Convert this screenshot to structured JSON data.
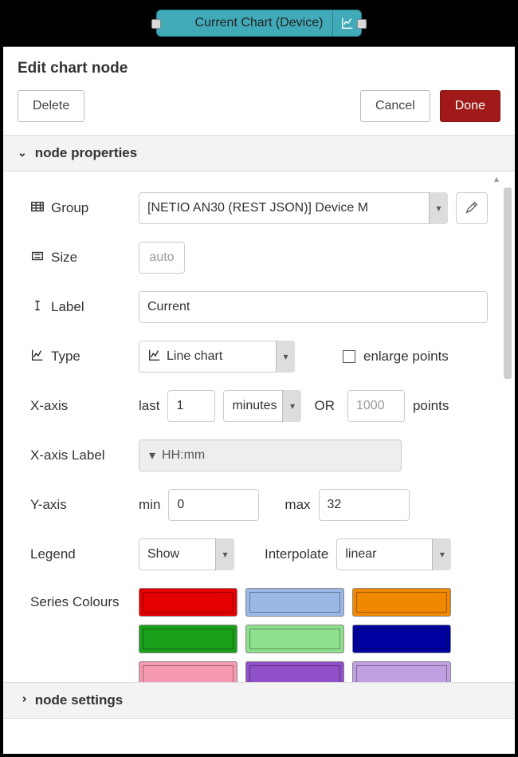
{
  "node": {
    "title": "Current Chart (Device)"
  },
  "header": {
    "title": "Edit chart node"
  },
  "buttons": {
    "delete": "Delete",
    "cancel": "Cancel",
    "done": "Done"
  },
  "sections": {
    "properties": "node properties",
    "settings": "node settings"
  },
  "labels": {
    "group": "Group",
    "size": "Size",
    "label": "Label",
    "type": "Type",
    "xaxis": "X-axis",
    "xaxis_label": "X-axis Label",
    "yaxis": "Y-axis",
    "legend": "Legend",
    "interpolate": "Interpolate",
    "series": "Series Colours",
    "enlarge": "enlarge points",
    "last": "last",
    "or": "OR",
    "points": "points",
    "min": "min",
    "max": "max"
  },
  "fields": {
    "group": "[NETIO AN30 (REST JSON)] Device M",
    "size": "auto",
    "label": "Current",
    "type": "Line chart",
    "xaxis_count": "1",
    "xaxis_unit": "minutes",
    "xaxis_points_ph": "1000",
    "xaxis_label_fmt": "HH:mm",
    "ymin": "0",
    "ymax": "32",
    "legend": "Show",
    "interpolate": "linear"
  },
  "colors": [
    "#e40000",
    "#9ab8e6",
    "#f08800",
    "#1ba01b",
    "#8ee08e",
    "#0000a0",
    "#f59ab0",
    "#9050c8",
    "#c0a0e0"
  ]
}
